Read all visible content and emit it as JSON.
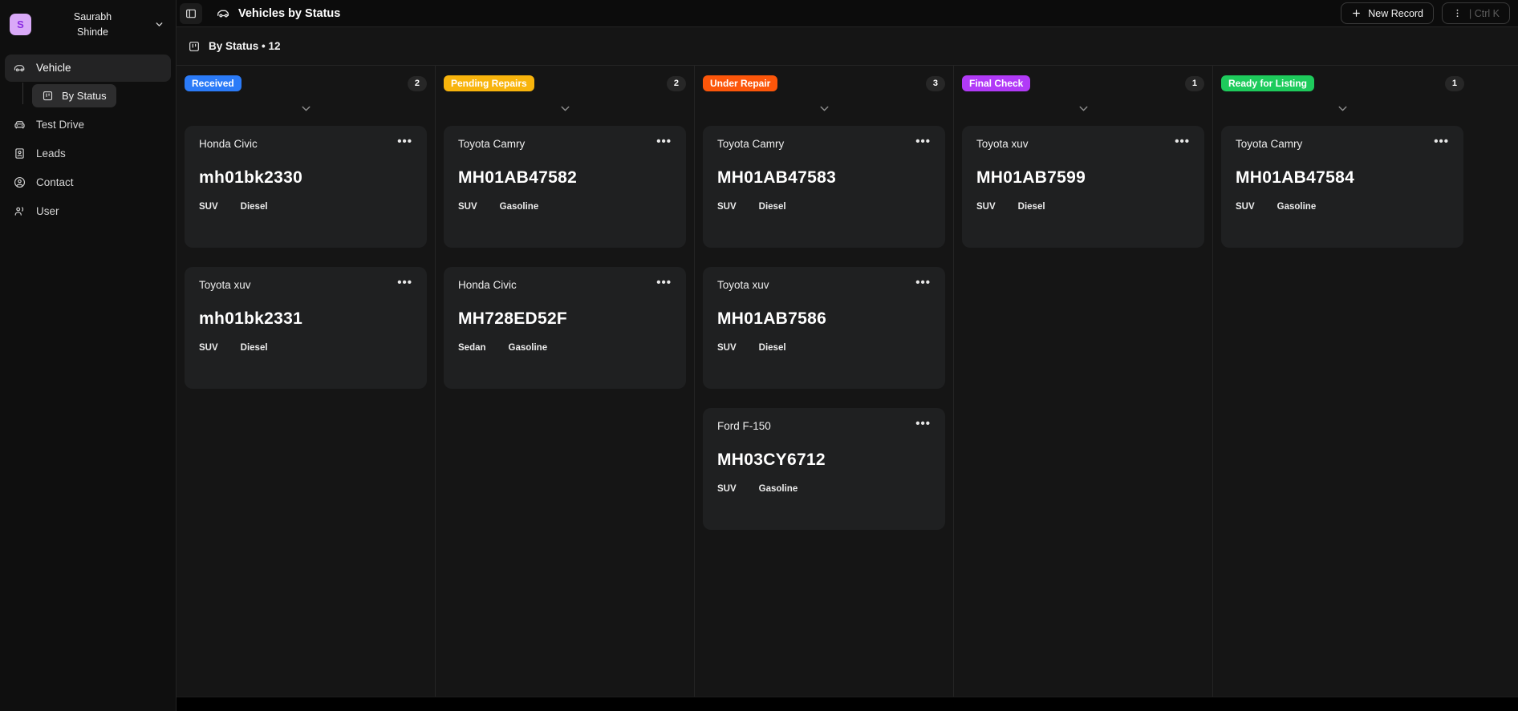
{
  "sidebar": {
    "user": {
      "initial": "S",
      "name_lines": [
        "Saurabh",
        "Shinde"
      ]
    },
    "items": [
      {
        "label": "Vehicle"
      },
      {
        "label": "By Status"
      },
      {
        "label": "Test Drive"
      },
      {
        "label": "Leads"
      },
      {
        "label": "Contact"
      },
      {
        "label": "User"
      }
    ]
  },
  "header": {
    "title": "Vehicles by Status",
    "new_record_label": "New Record",
    "shortcut": "| Ctrl K"
  },
  "toolbar": {
    "view_label": "By Status • 12"
  },
  "colors": {
    "received": "#2b7bf8",
    "pending_repairs": "#f8b40c",
    "under_repair": "#fc560a",
    "final_check": "#b13af7",
    "ready_for_listing": "#1ecb5c"
  },
  "board": {
    "columns": [
      {
        "name": "Received",
        "color": "#2b7bf8",
        "count": "2",
        "cards": [
          {
            "title": "Honda Civic",
            "plate": "mh01bk2330",
            "tags": [
              "SUV",
              "Diesel"
            ]
          },
          {
            "title": "Toyota xuv",
            "plate": "mh01bk2331",
            "tags": [
              "SUV",
              "Diesel"
            ]
          }
        ]
      },
      {
        "name": "Pending Repairs",
        "color": "#f8b40c",
        "count": "2",
        "cards": [
          {
            "title": "Toyota Camry",
            "plate": "MH01AB47582",
            "tags": [
              "SUV",
              "Gasoline"
            ]
          },
          {
            "title": "Honda Civic",
            "plate": "MH728ED52F",
            "tags": [
              "Sedan",
              "Gasoline"
            ]
          }
        ]
      },
      {
        "name": "Under Repair",
        "color": "#fc560a",
        "count": "3",
        "cards": [
          {
            "title": "Toyota Camry",
            "plate": "MH01AB47583",
            "tags": [
              "SUV",
              "Diesel"
            ]
          },
          {
            "title": "Toyota xuv",
            "plate": "MH01AB7586",
            "tags": [
              "SUV",
              "Diesel"
            ]
          },
          {
            "title": "Ford F-150",
            "plate": "MH03CY6712",
            "tags": [
              "SUV",
              "Gasoline"
            ]
          }
        ]
      },
      {
        "name": "Final Check",
        "color": "#b13af7",
        "count": "1",
        "cards": [
          {
            "title": "Toyota xuv",
            "plate": "MH01AB7599",
            "tags": [
              "SUV",
              "Diesel"
            ]
          }
        ]
      },
      {
        "name": "Ready for Listing",
        "color": "#1ecb5c",
        "count": "1",
        "cards": [
          {
            "title": "Toyota Camry",
            "plate": "MH01AB47584",
            "tags": [
              "SUV",
              "Gasoline"
            ]
          }
        ]
      }
    ]
  }
}
